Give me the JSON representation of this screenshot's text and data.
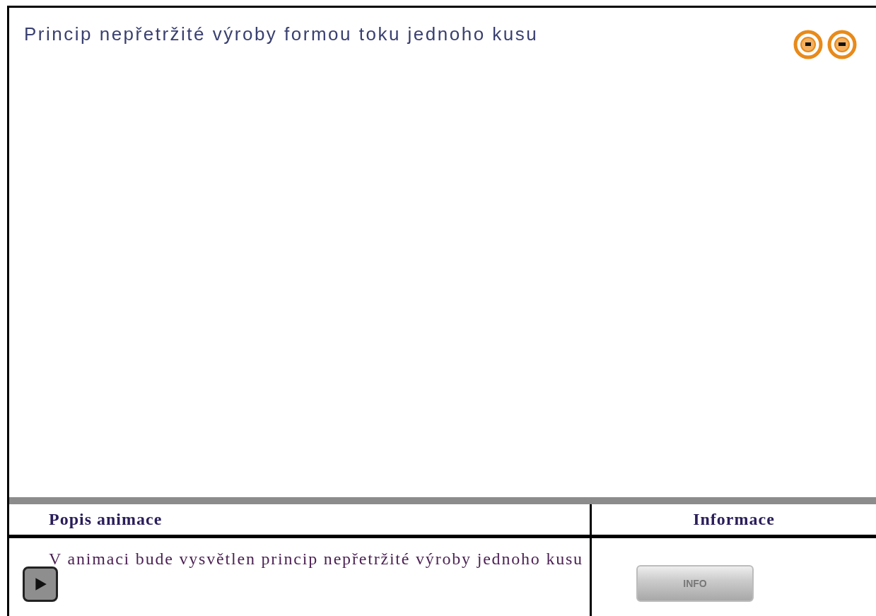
{
  "title": "Princip nepřetržité výroby formou toku jednoho kusu",
  "table": {
    "columns": [
      "Popis animace",
      "Informace"
    ],
    "description": "V animaci bude vysvětlen princip nepřetržité výroby jednoho kusu",
    "info_button": "INFO"
  }
}
